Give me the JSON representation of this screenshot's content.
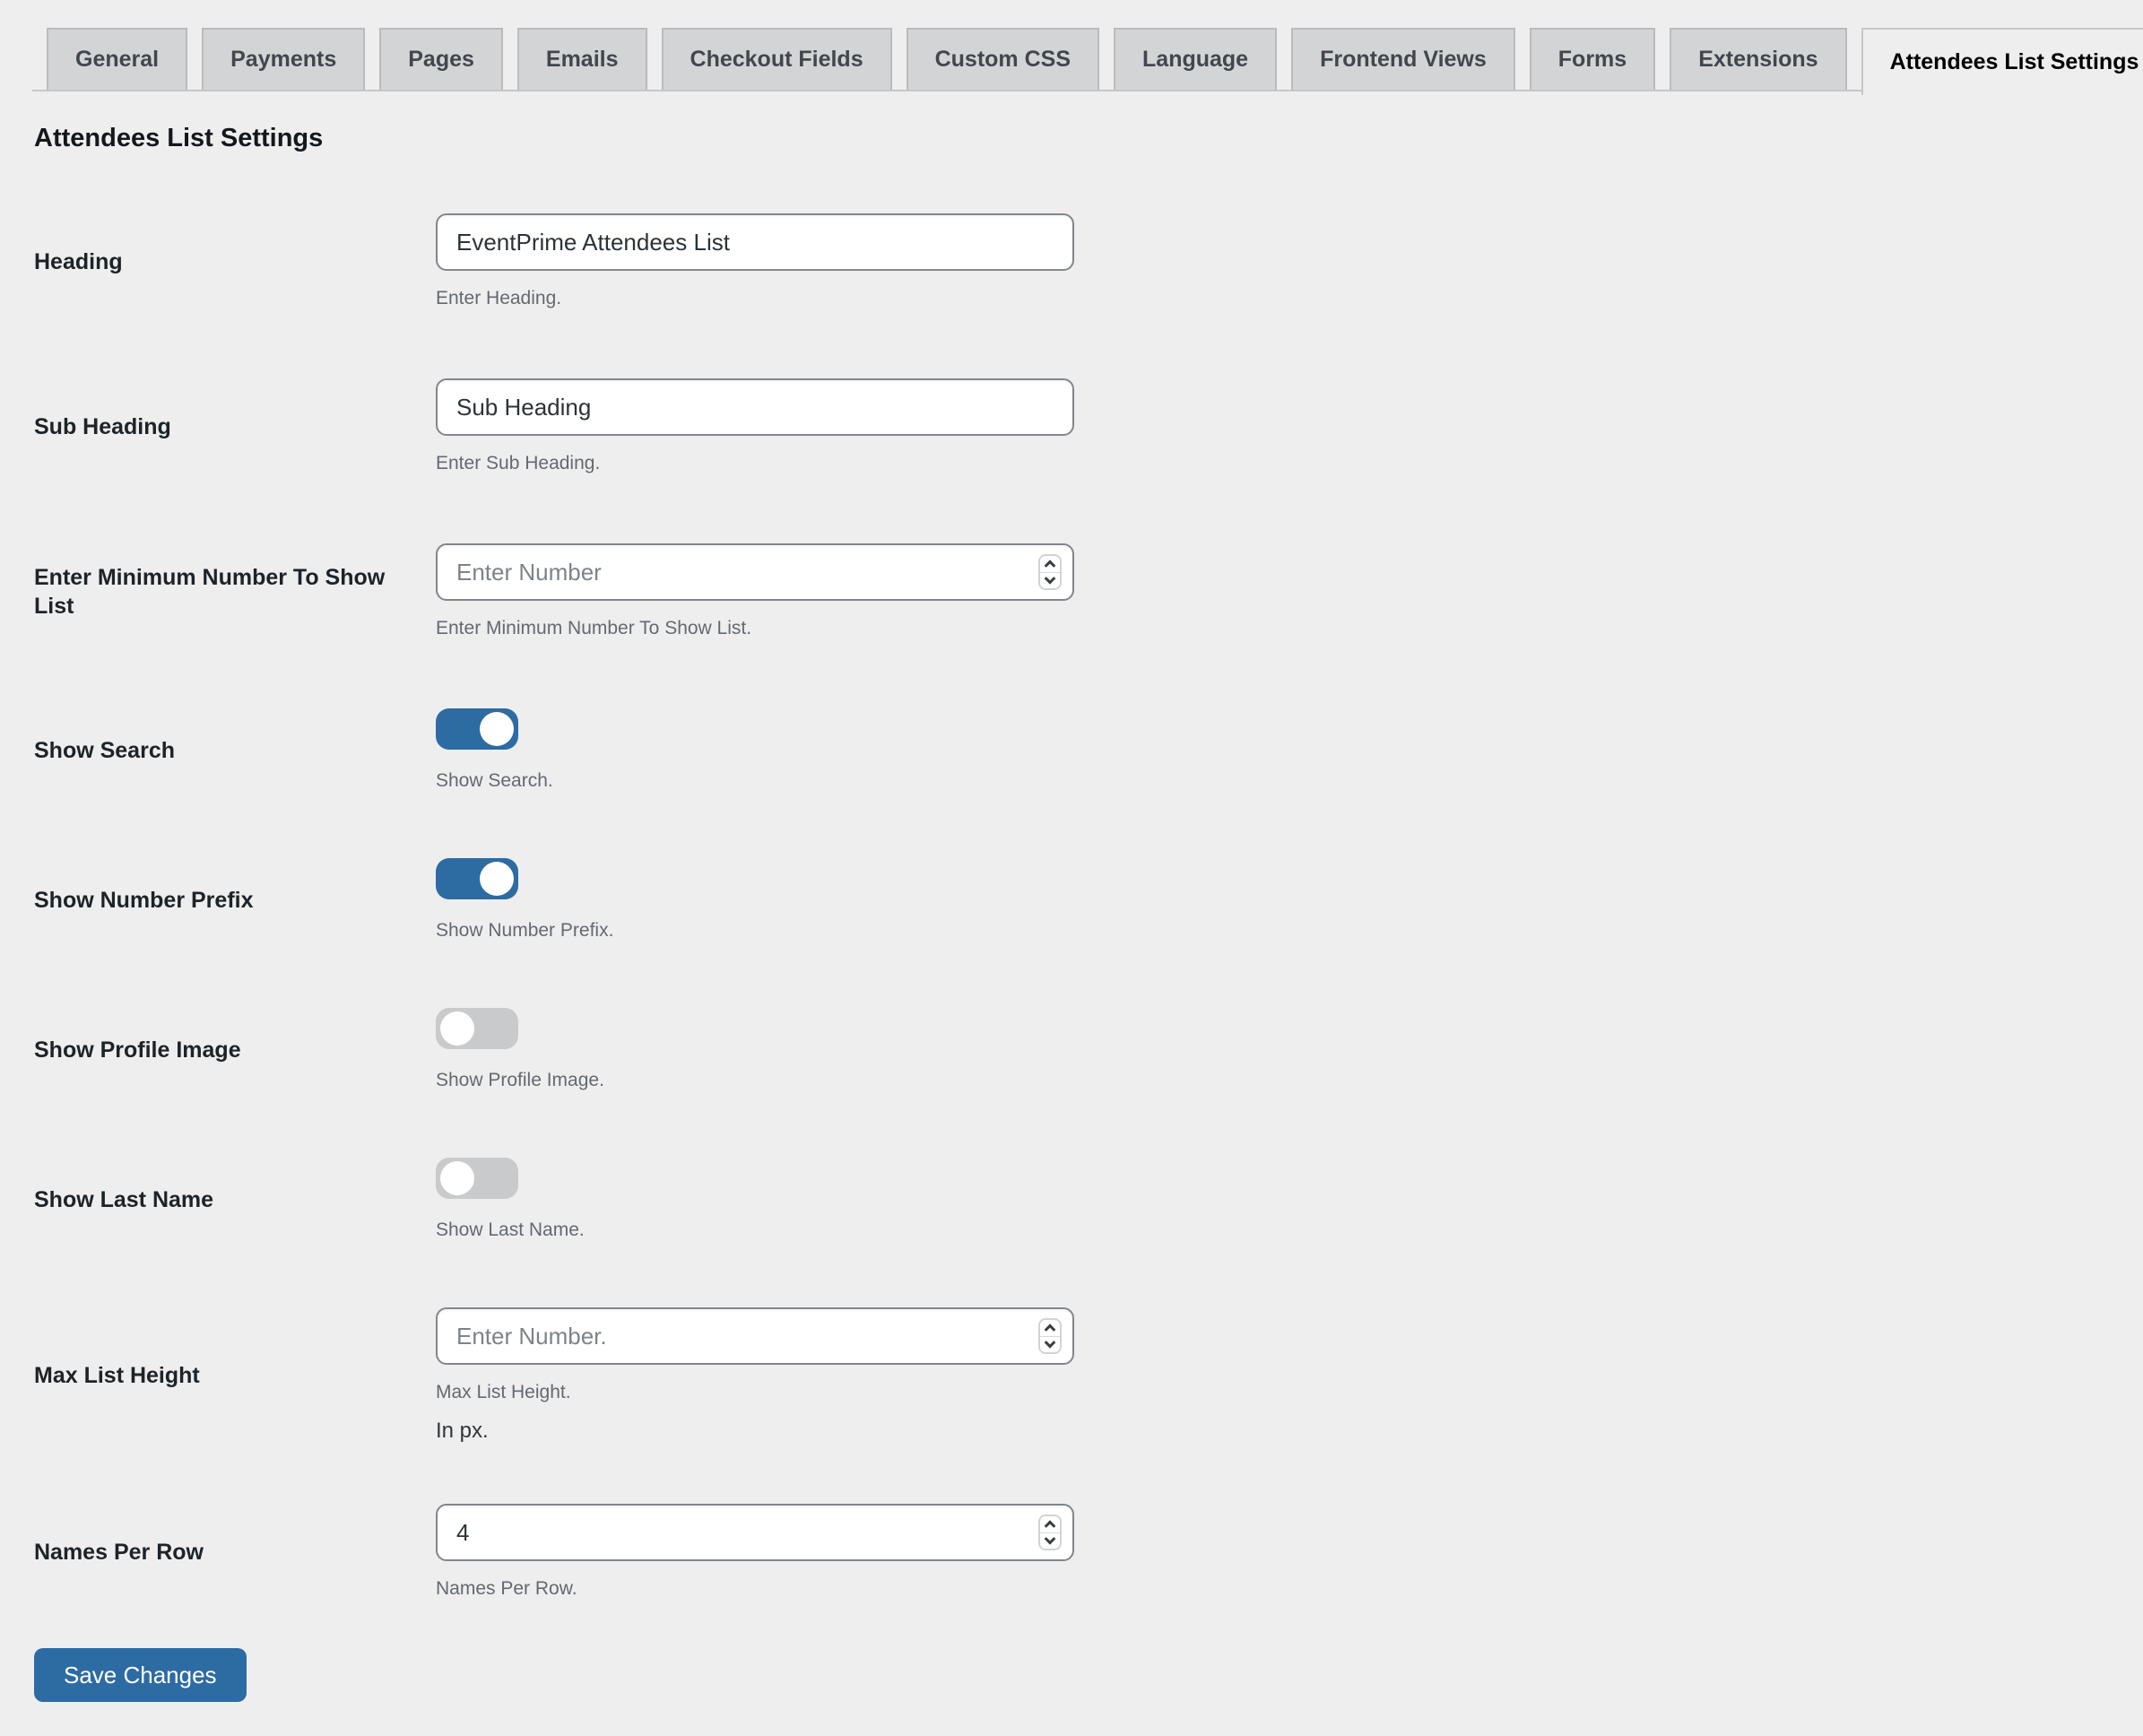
{
  "tabs": [
    {
      "label": "General",
      "active": false
    },
    {
      "label": "Payments",
      "active": false
    },
    {
      "label": "Pages",
      "active": false
    },
    {
      "label": "Emails",
      "active": false
    },
    {
      "label": "Checkout Fields",
      "active": false
    },
    {
      "label": "Custom CSS",
      "active": false
    },
    {
      "label": "Language",
      "active": false
    },
    {
      "label": "Frontend Views",
      "active": false
    },
    {
      "label": "Forms",
      "active": false
    },
    {
      "label": "Extensions",
      "active": false
    },
    {
      "label": "Attendees List Settings",
      "active": true
    }
  ],
  "page_title": "Attendees List Settings",
  "fields": [
    {
      "type": "text",
      "label": "Heading",
      "value": "EventPrime Attendees List",
      "help": "Enter Heading."
    },
    {
      "type": "text",
      "label": "Sub Heading",
      "value": "Sub Heading",
      "help": "Enter Sub Heading."
    },
    {
      "type": "number",
      "label": "Enter Minimum Number To Show List",
      "placeholder": "Enter Number",
      "help": "Enter Minimum Number To Show List."
    },
    {
      "type": "toggle",
      "label": "Show Search",
      "on": true,
      "help": "Show Search."
    },
    {
      "type": "toggle",
      "label": "Show Number Prefix",
      "on": true,
      "help": "Show Number Prefix."
    },
    {
      "type": "toggle",
      "label": "Show Profile Image",
      "on": false,
      "help": "Show Profile Image."
    },
    {
      "type": "toggle",
      "label": "Show Last Name",
      "on": false,
      "help": "Show Last Name."
    },
    {
      "type": "number",
      "label": "Max List Height",
      "placeholder": "Enter Number.",
      "help": "Max List Height.",
      "note": "In px."
    },
    {
      "type": "number",
      "label": "Names Per Row",
      "value": "4",
      "help": "Names Per Row."
    }
  ],
  "save_button_label": "Save Changes",
  "colors": {
    "accent_blue": "#2d6ba3",
    "toggle_off_gray": "#c9cacb",
    "page_background": "#eeeeef"
  }
}
